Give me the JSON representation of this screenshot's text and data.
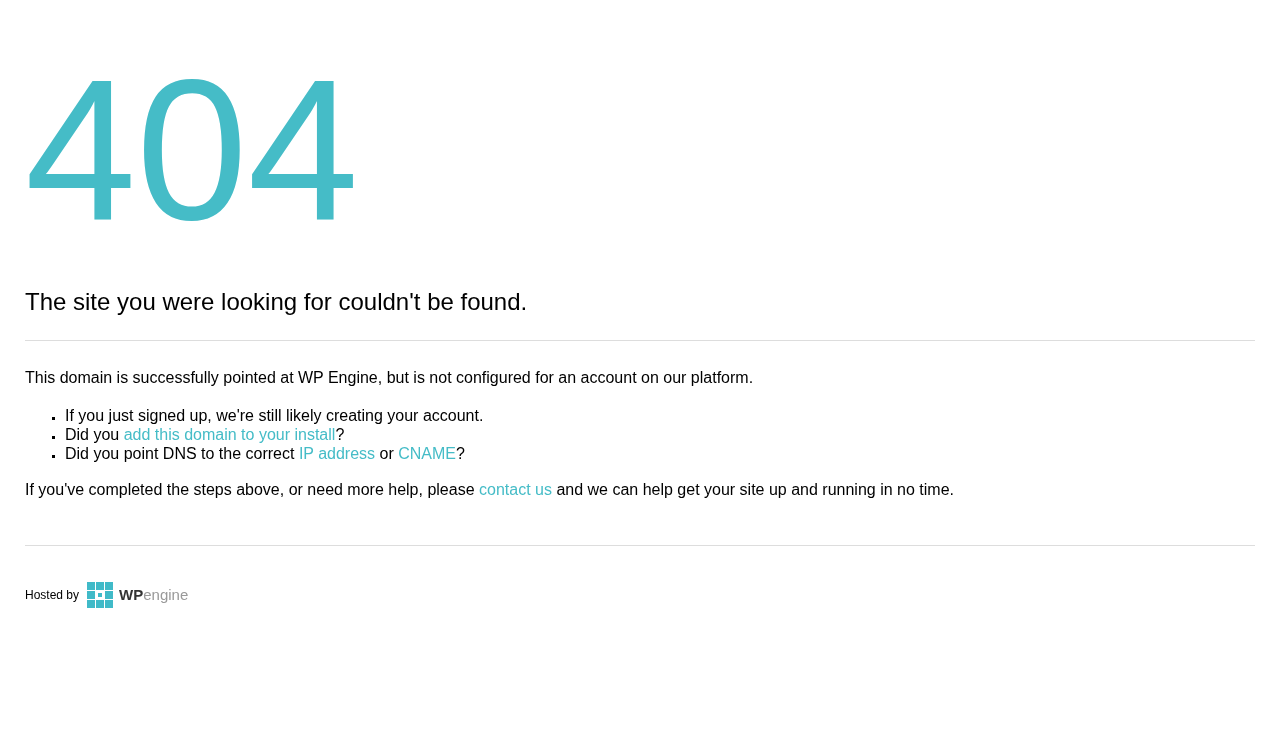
{
  "error_code": "404",
  "heading": "The site you were looking for couldn't be found.",
  "intro": "This domain is successfully pointed at WP Engine, but is not configured for an account on our platform.",
  "bullets": [
    [
      {
        "kind": "text",
        "text": "If you just signed up, we're still likely creating your account."
      }
    ],
    [
      {
        "kind": "text",
        "text": "Did you "
      },
      {
        "kind": "link",
        "text": "add this domain to your install"
      },
      {
        "kind": "text",
        "text": "?"
      }
    ],
    [
      {
        "kind": "text",
        "text": "Did you point DNS to the correct "
      },
      {
        "kind": "link",
        "text": "IP address"
      },
      {
        "kind": "text",
        "text": " or "
      },
      {
        "kind": "link",
        "text": "CNAME"
      },
      {
        "kind": "text",
        "text": "?"
      }
    ]
  ],
  "closing": [
    {
      "kind": "text",
      "text": "If you've completed the steps above, or need more help, please "
    },
    {
      "kind": "link",
      "text": "contact us"
    },
    {
      "kind": "text",
      "text": " and we can help get your site up and running in no time."
    }
  ],
  "footer": {
    "hosted_by": "Hosted by",
    "logo_bold": "WP",
    "logo_light": "engine"
  }
}
